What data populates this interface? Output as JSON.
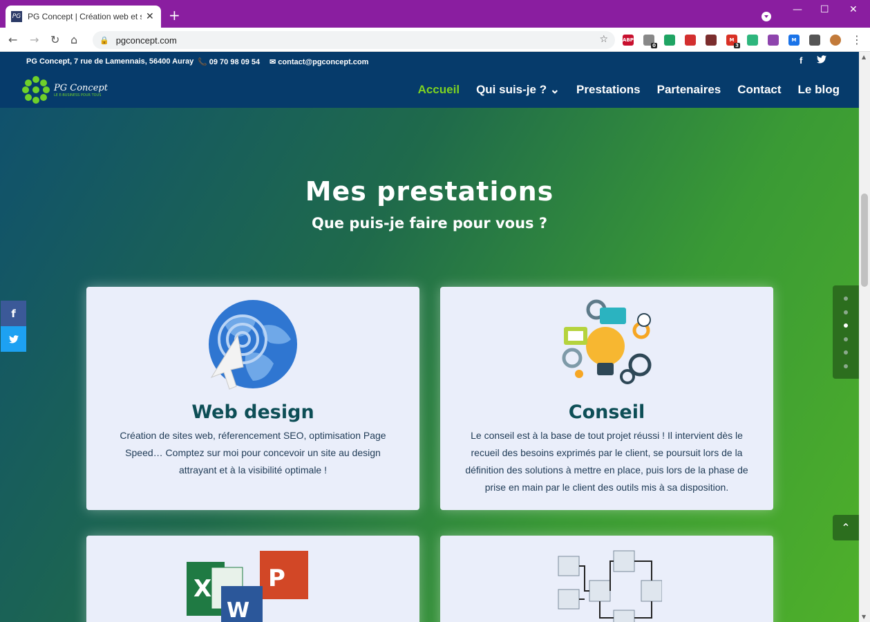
{
  "browser": {
    "tab_title": "PG Concept | Création web et so",
    "tab_favicon": "PG",
    "new_tab": "+",
    "url": "pgconcept.com",
    "close_tab": "✕",
    "minimize": "—",
    "maximize": "☐",
    "close_window": "✕",
    "back": "←",
    "forward": "→",
    "reload": "↻",
    "home": "⌂",
    "menu": "⋮",
    "extensions": [
      {
        "name": "adblock-icon",
        "label": "ABP",
        "color": "#c8102e"
      },
      {
        "name": "ghost-icon",
        "label": "",
        "color": "#888",
        "badge": "0"
      },
      {
        "name": "drive-icon",
        "label": "",
        "color": "#1fa463"
      },
      {
        "name": "pdf-icon",
        "label": "",
        "color": "#d32f2f"
      },
      {
        "name": "tool-icon",
        "label": "",
        "color": "#7b2d2d"
      },
      {
        "name": "gmail-icon",
        "label": "M",
        "color": "#d93025",
        "badge": "3"
      },
      {
        "name": "note-icon",
        "label": "",
        "color": "#2eb67d"
      },
      {
        "name": "tracker-icon",
        "label": "",
        "color": "#8e44ad"
      },
      {
        "name": "m-icon",
        "label": "M",
        "color": "#1a73e8"
      },
      {
        "name": "puzzle-icon",
        "label": "",
        "color": "#555"
      },
      {
        "name": "avatar-icon",
        "label": "",
        "color": "#c27a3a"
      }
    ]
  },
  "site": {
    "address": "PG Concept, 7 rue de Lamennais, 56400 Auray",
    "phone": "📞 09 70 98 09 54",
    "email": "✉ contact@pgconcept.com",
    "facebook": "f",
    "twitter": "🐦",
    "logo_name": "PG Concept",
    "logo_tagline": "LE E-BUSINESS POUR TOUS",
    "nav": [
      {
        "label": "Accueil",
        "active": true
      },
      {
        "label": "Qui suis-je ? ⌄",
        "active": false
      },
      {
        "label": "Prestations",
        "active": false
      },
      {
        "label": "Partenaires",
        "active": false
      },
      {
        "label": "Contact",
        "active": false
      },
      {
        "label": "Le blog",
        "active": false
      }
    ]
  },
  "section": {
    "title": "Mes prestations",
    "subtitle": "Que puis-je faire pour vous ?"
  },
  "cards": [
    {
      "title": "Web design",
      "text": "Création de sites web, réferencement SEO, optimisation Page Speed… Comptez sur moi pour concevoir un site au design attrayant et à la visibilité optimale !"
    },
    {
      "title": "Conseil",
      "text": "Le conseil est à la base de tout projet réussi ! Il intervient dès le recueil des besoins exprimés par le client, se poursuit lors de la définition des solutions à mettre en place, puis lors de la phase de prise en main par le client des outils mis à sa disposition."
    }
  ],
  "share": {
    "facebook": "f",
    "twitter": "🐦"
  },
  "back_to_top": "⌃"
}
